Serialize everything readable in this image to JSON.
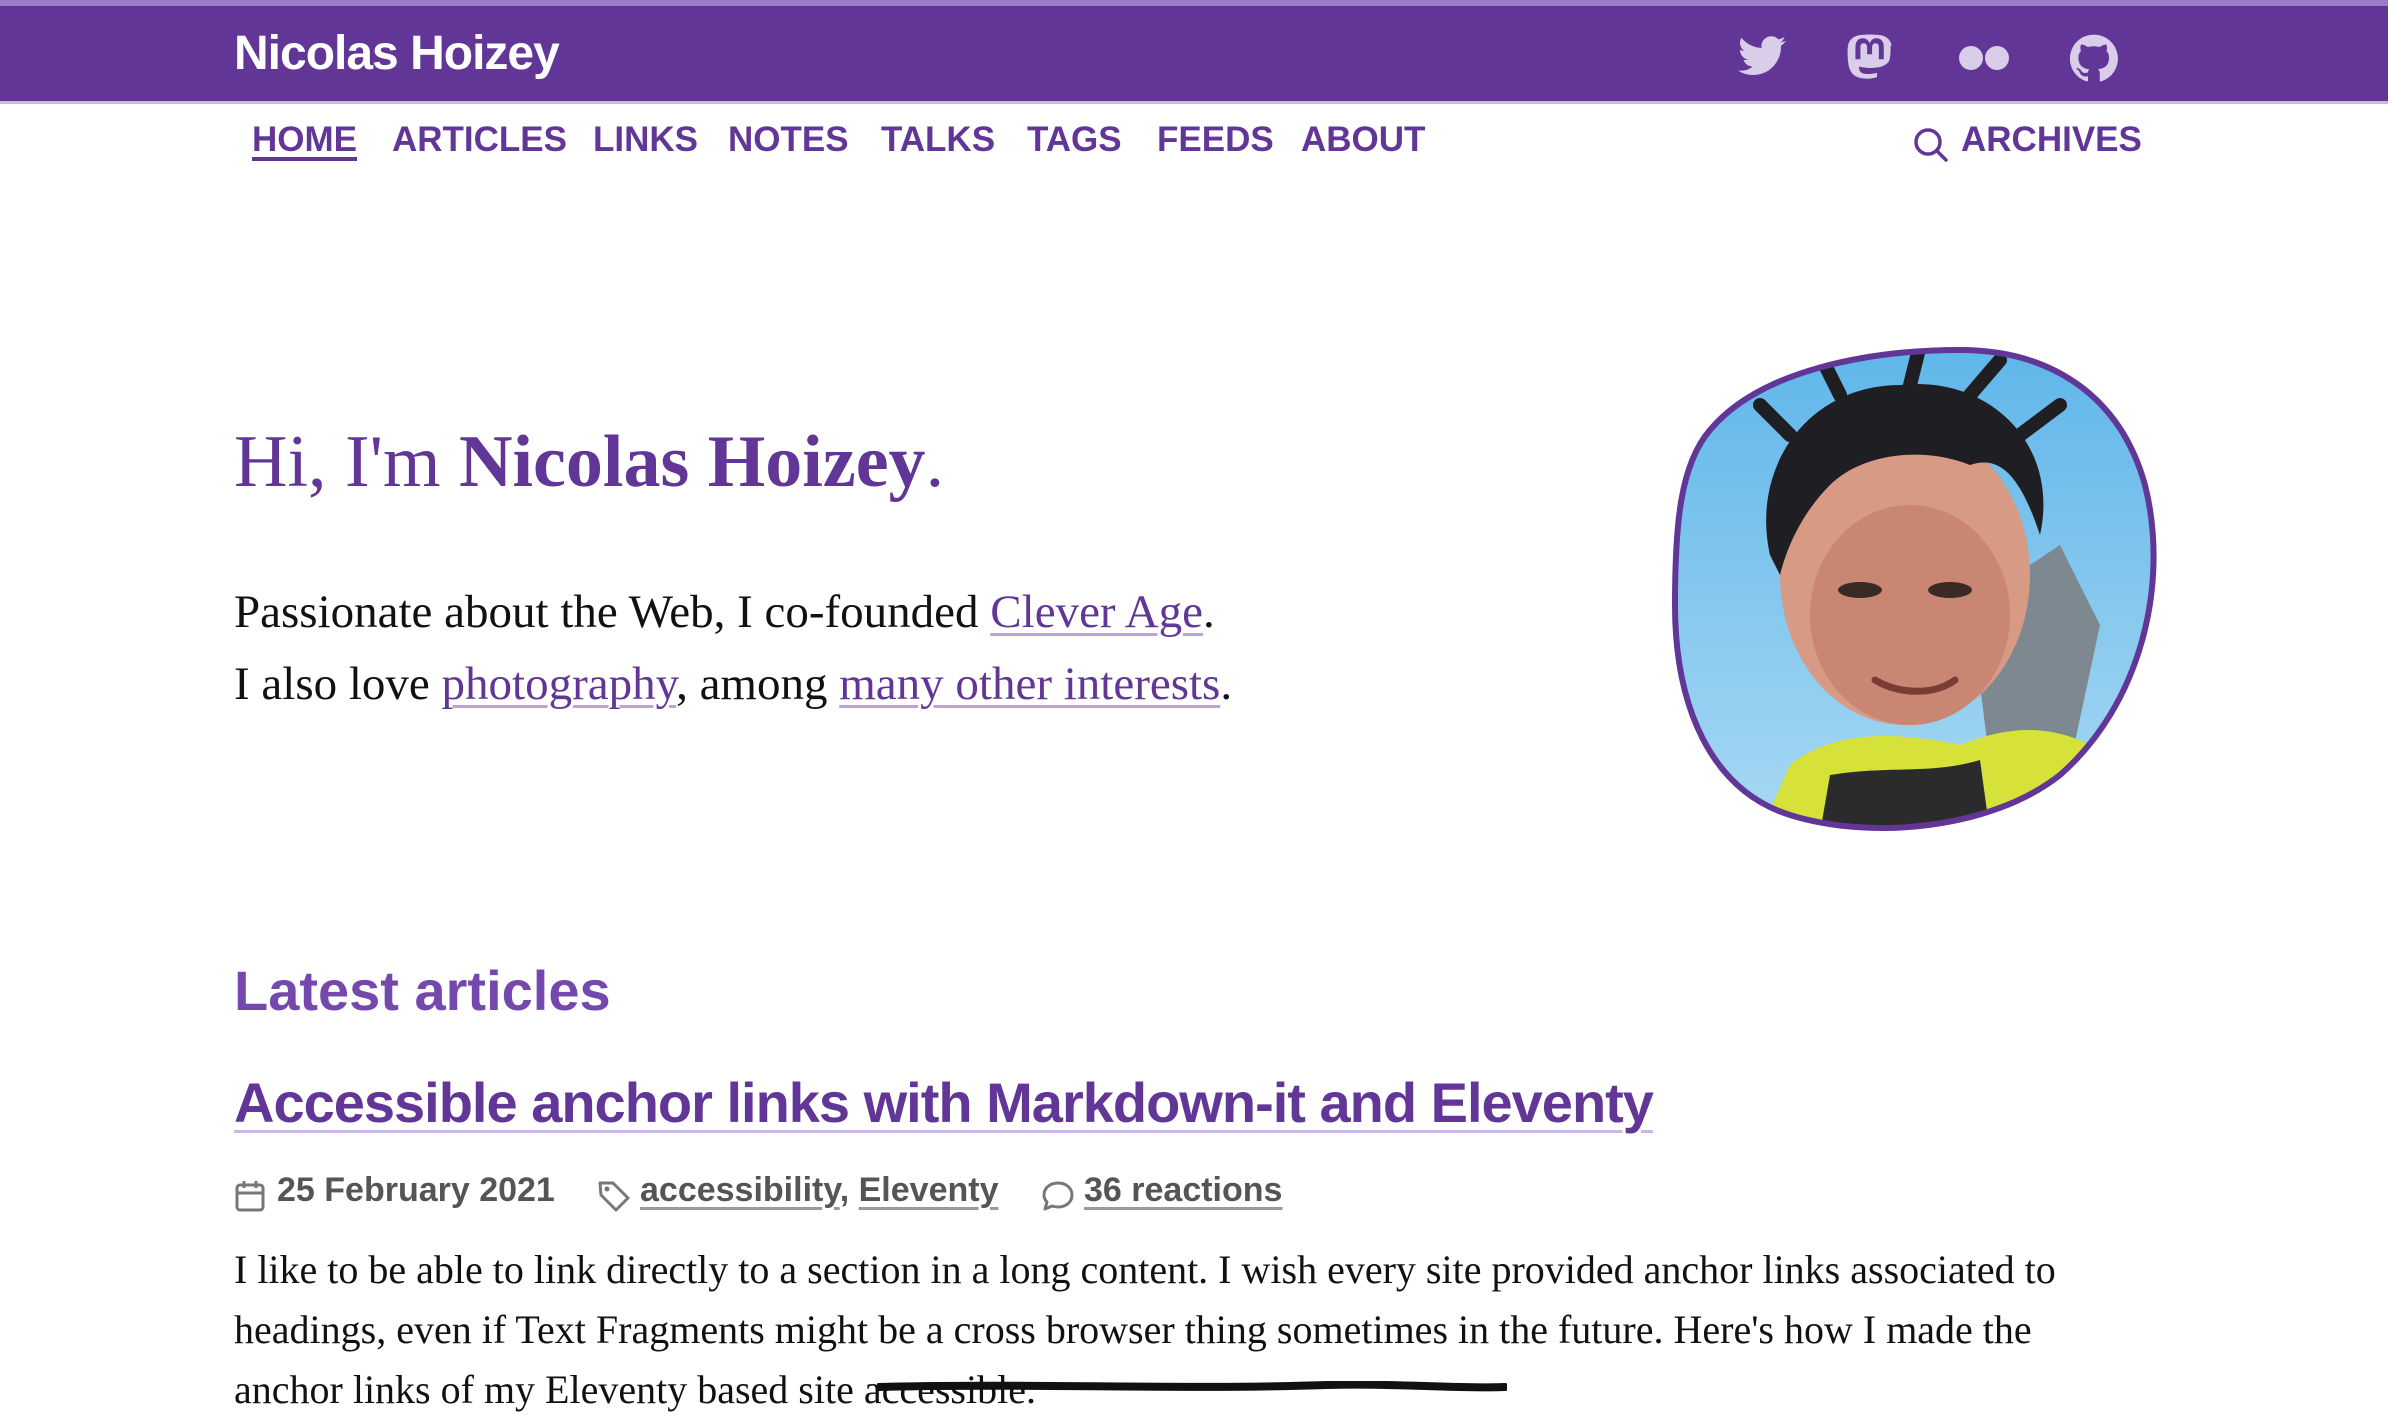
{
  "site": {
    "title": "Nicolas Hoizey",
    "accent_color": "#623697",
    "social_icons": [
      "twitter-icon",
      "mastodon-icon",
      "flickr-icon",
      "github-icon"
    ]
  },
  "nav": {
    "items": [
      {
        "label": "HOME",
        "active": true
      },
      {
        "label": "ARTICLES"
      },
      {
        "label": "LINKS"
      },
      {
        "label": "NOTES"
      },
      {
        "label": "TALKS"
      },
      {
        "label": "TAGS"
      },
      {
        "label": "FEEDS"
      },
      {
        "label": "ABOUT"
      }
    ],
    "archives_label": "ARCHIVES"
  },
  "hero": {
    "greeting": "Hi, I'm ",
    "name": "Nicolas Hoizey",
    "period": ".",
    "line1_prefix": "Passionate about the Web, I co-founded ",
    "line1_link": "Clever Age",
    "line1_suffix": ".",
    "line2_prefix": "I also love ",
    "line2_link1": "photography",
    "line2_middle": ", among ",
    "line2_link2": "many other interests",
    "line2_suffix": "."
  },
  "latest": {
    "heading": "Latest articles",
    "article": {
      "title": "Accessible anchor links with Markdown-it and Eleventy",
      "date": "25 February 2021",
      "tags": [
        "accessibility",
        "Eleventy"
      ],
      "tag_separator": ",",
      "reactions": "36 reactions",
      "excerpt": "I like to be able to link directly to a section in a long content. I wish every site provided anchor links associated to headings, even if Text Fragments might be a cross browser thing sometimes in the future. Here's how I made the anchor links of my Eleventy based site accessible."
    }
  }
}
